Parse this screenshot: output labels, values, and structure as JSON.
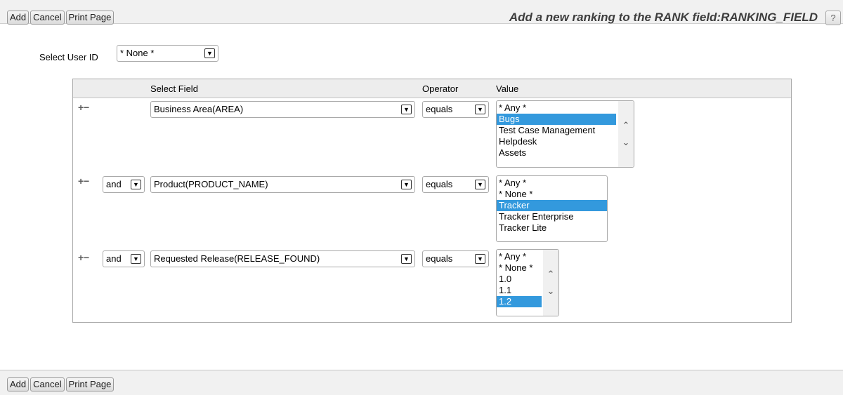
{
  "toolbar": {
    "add_label": "Add",
    "cancel_label": "Cancel",
    "print_label": "Print Page",
    "title": "Add a new ranking to the RANK field:RANKING_FIELD",
    "help_label": "?"
  },
  "user": {
    "label": "Select User ID",
    "value": "* None *"
  },
  "headers": {
    "field": "Select Field",
    "operator": "Operator",
    "value": "Value"
  },
  "rows": [
    {
      "conjunction": "",
      "field": "Business Area(AREA)",
      "operator": "equals",
      "values": [
        "* Any *",
        "Bugs",
        "Test Case Management",
        "Helpdesk",
        "Assets"
      ],
      "selected": [
        1
      ]
    },
    {
      "conjunction": "and",
      "field": "Product(PRODUCT_NAME)",
      "operator": "equals",
      "values": [
        "* Any *",
        "* None *",
        "Tracker",
        "Tracker Enterprise",
        "Tracker Lite"
      ],
      "selected": [
        2
      ]
    },
    {
      "conjunction": "and",
      "field": "Requested Release(RELEASE_FOUND)",
      "operator": "equals",
      "values": [
        "* Any *",
        "* None *",
        "1.0",
        "1.1",
        "1.2"
      ],
      "selected": [
        4
      ]
    }
  ],
  "icons": {
    "add": "plus-icon",
    "remove": "minus-icon",
    "dropdown": "chevron-down-icon",
    "scroll_up": "chevron-up-icon",
    "scroll_down": "chevron-down-icon"
  },
  "colors": {
    "selection": "#3399dd",
    "toolbar_bg": "#f1f1f1",
    "header_bg": "#ededed"
  }
}
